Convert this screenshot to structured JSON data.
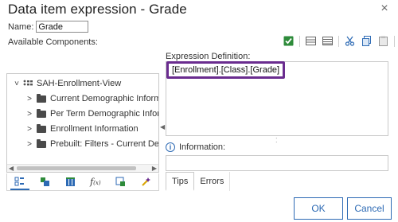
{
  "dialog": {
    "title": "Data item expression - Grade",
    "close_glyph": "×"
  },
  "name": {
    "label": "Name:",
    "value": "Grade"
  },
  "available_components_label": "Available Components:",
  "toolbar": {
    "icons": [
      "validate-icon",
      "grid-icon",
      "grid-alt-icon",
      "cut-icon",
      "copy-icon",
      "paste-icon",
      "delete-icon"
    ]
  },
  "tree": {
    "root": {
      "expand_glyph": "˅",
      "label": "SAH-Enrollment-View"
    },
    "items": [
      {
        "label": "Current Demographic Informati",
        "expand_glyph": ">"
      },
      {
        "label": "Per Term Demographic Inform",
        "expand_glyph": ">"
      },
      {
        "label": "Enrollment Information",
        "expand_glyph": ">"
      },
      {
        "label": "Prebuilt: Filters - Current Demo",
        "expand_glyph": ">"
      }
    ]
  },
  "left_tabs": [
    "source-tab-icon",
    "data-items-tab-icon",
    "parameters-tab-icon",
    "functions-tab-icon",
    "query-items-tab-icon",
    "macros-tab-icon"
  ],
  "expression": {
    "label": "Expression Definition:",
    "value": "[Enrollment].[Class].[Grade]"
  },
  "information": {
    "label": "Information:",
    "icon_glyph": "i"
  },
  "right_tabs": {
    "tips": "Tips",
    "errors": "Errors"
  },
  "buttons": {
    "ok": "OK",
    "cancel": "Cancel"
  },
  "colors": {
    "accent": "#2d6ab4",
    "highlight_border": "#6a2c8f",
    "delete_red": "#d32f2f",
    "validate_green": "#2e8b3a"
  }
}
